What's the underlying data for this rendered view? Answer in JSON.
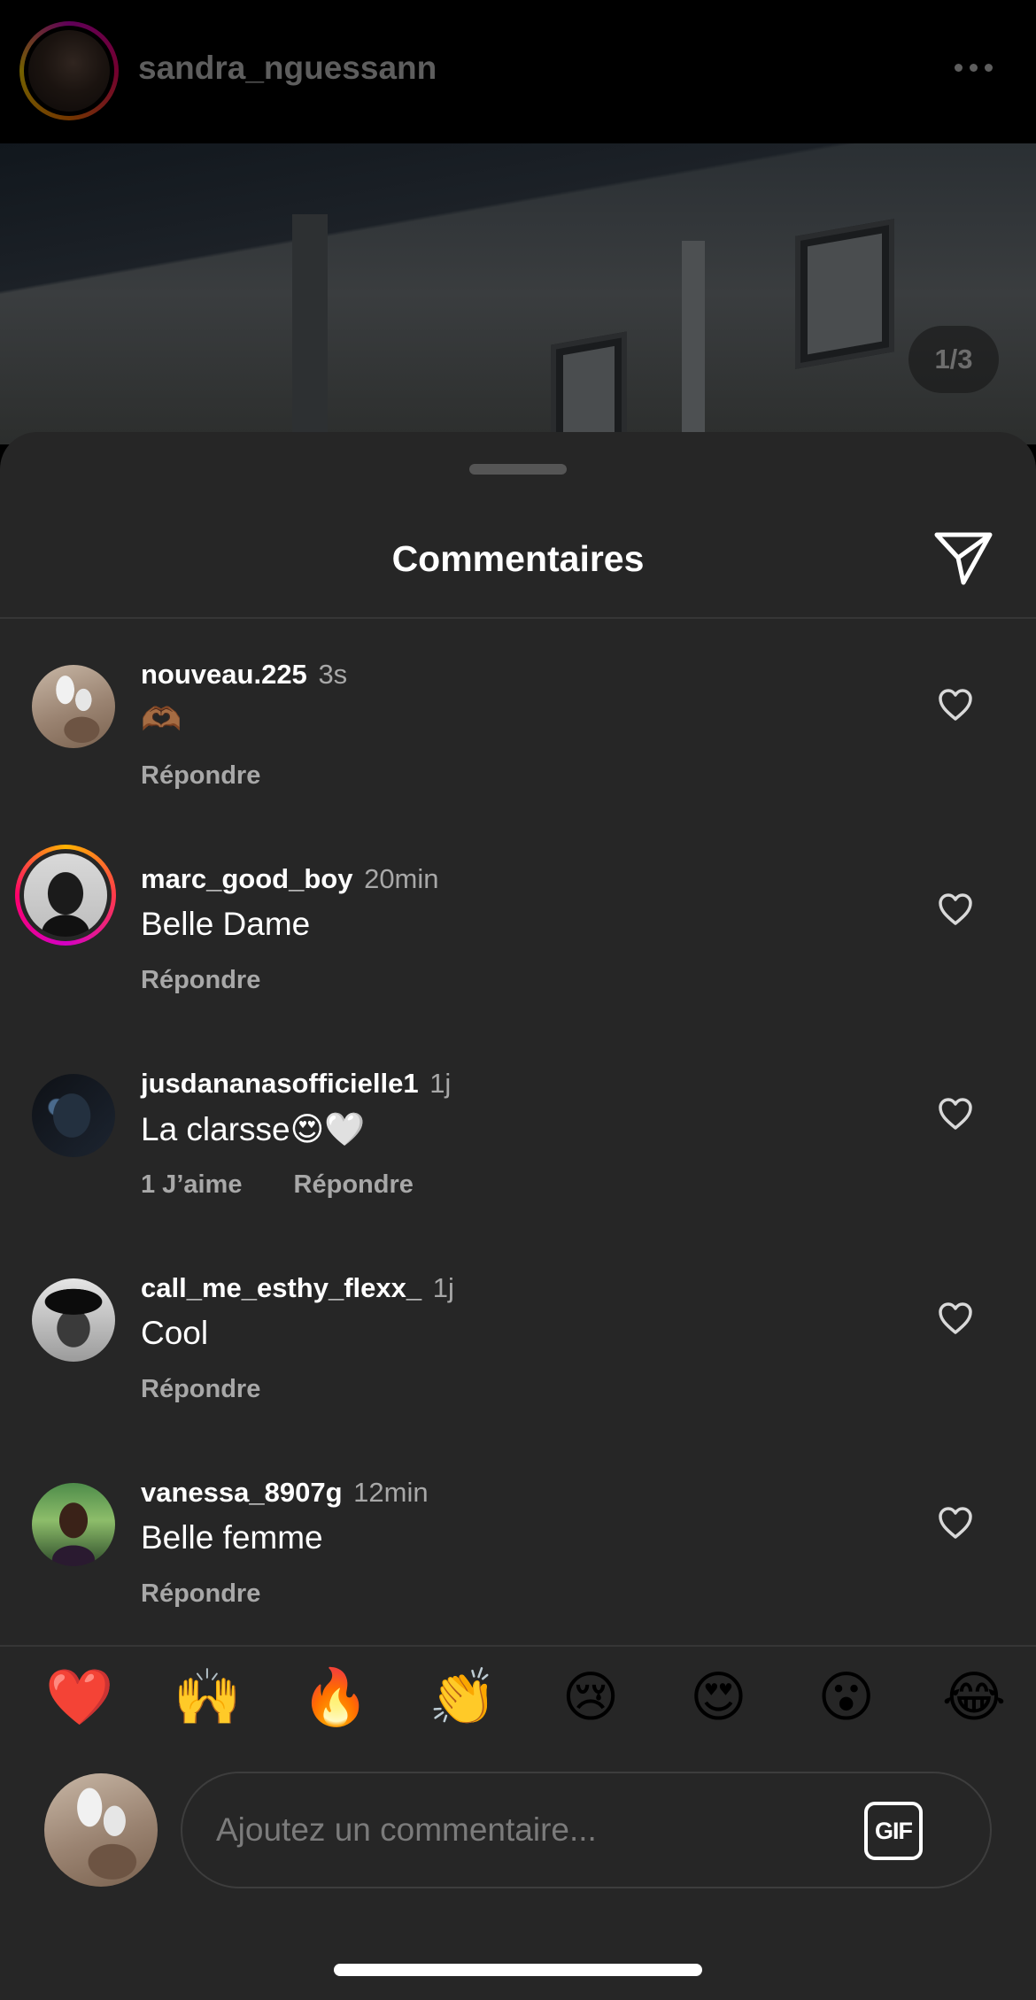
{
  "post": {
    "username": "sandra_nguessann",
    "image_counter": "1/3"
  },
  "sheet": {
    "title": "Commentaires"
  },
  "comments": [
    {
      "username": "nouveau.225",
      "time": "3s",
      "text": "🫶🏾",
      "likes": "",
      "reply_label": "Répondre"
    },
    {
      "username": "marc_good_boy",
      "time": "20min",
      "text": "Belle Dame",
      "likes": "",
      "reply_label": "Répondre"
    },
    {
      "username": "jusdananasofficielle1",
      "time": "1j",
      "text": "La clarsse😍🤍",
      "likes": "1 J’aime",
      "reply_label": "Répondre"
    },
    {
      "username": "call_me_esthy_flexx_",
      "time": "1j",
      "text": "Cool",
      "likes": "",
      "reply_label": "Répondre"
    },
    {
      "username": "vanessa_8907g",
      "time": "12min",
      "text": "Belle femme",
      "likes": "",
      "reply_label": "Répondre"
    }
  ],
  "quick_emojis": [
    "❤️",
    "🙌",
    "🔥",
    "👏",
    "😢",
    "😍",
    "😮",
    "😂"
  ],
  "composer": {
    "placeholder": "Ajoutez un commentaire...",
    "gif_label": "GIF"
  },
  "icons": {
    "share": "paper-plane-icon",
    "like": "heart-outline-icon",
    "more": "more-horizontal-icon"
  }
}
